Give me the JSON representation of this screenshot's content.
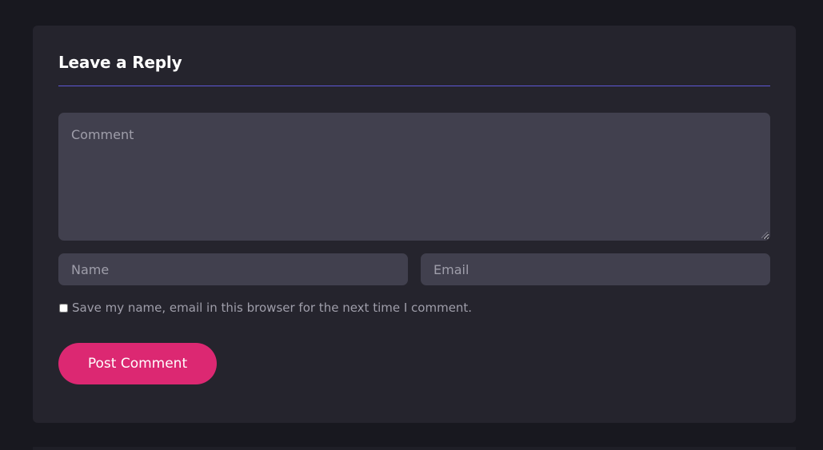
{
  "reply": {
    "title": "Leave a Reply",
    "comment_placeholder": "Comment",
    "name_placeholder": "Name",
    "email_placeholder": "Email",
    "consent_label": "Save my name, email in this browser for the next time I comment.",
    "submit_label": "Post Comment"
  },
  "colors": {
    "page_background": "#18181f",
    "card_background": "#25242d",
    "field_background": "#41404e",
    "accent_line": "#5e57d6",
    "submit_button": "#dc2872"
  },
  "state": {
    "consent_checked": false
  }
}
